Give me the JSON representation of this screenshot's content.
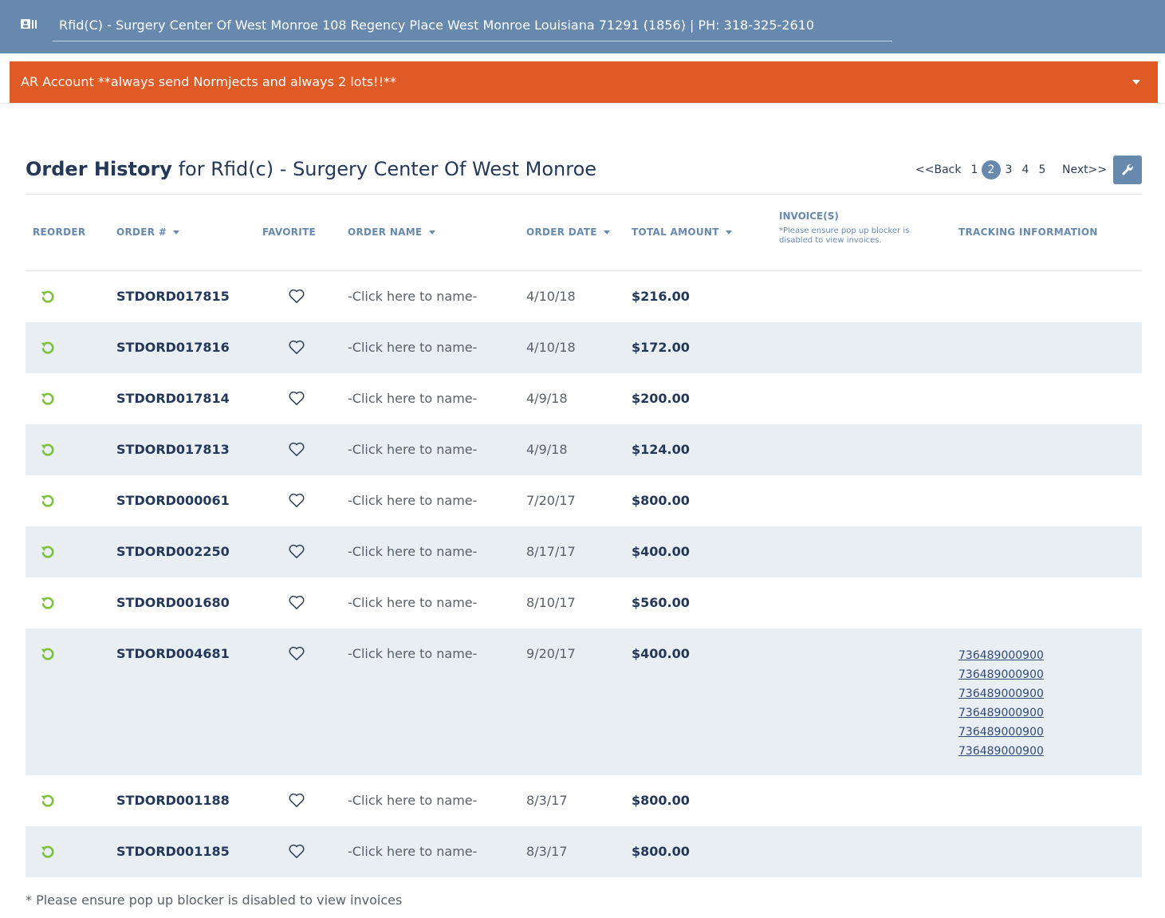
{
  "header": {
    "account_text": "Rfid(C) - Surgery Center Of West Monroe 108 Regency Place West Monroe Louisiana 71291 (1856)  | PH: 318-325-2610",
    "icon": "address-card-icon"
  },
  "alert": {
    "text": "AR Account **always send Normjects and always 2 lots!!**",
    "color": "#e05a26"
  },
  "page": {
    "title_bold": "Order History",
    "title_rest": " for Rfid(c) - Surgery Center Of West Monroe"
  },
  "pagination": {
    "back": "<<Back",
    "pages": [
      "1",
      "2",
      "3",
      "4",
      "5"
    ],
    "current": "2",
    "next": "Next>>",
    "settings_icon": "wrench-icon"
  },
  "table": {
    "columns": {
      "reorder": "REORDER",
      "order_no": "ORDER #",
      "favorite": "FAVORITE",
      "order_name": "ORDER NAME",
      "order_date": "ORDER DATE",
      "total_amount": "TOTAL AMOUNT",
      "invoices": "INVOICE(S)",
      "invoices_note": "*Please ensure pop up blocker is disabled to view invoices.",
      "tracking": "TRACKING INFORMATION"
    },
    "rows": [
      {
        "order_no": "STDORD017815",
        "name": "-Click here to name-",
        "date": "4/10/18",
        "amount": "$216.00",
        "tracking": []
      },
      {
        "order_no": "STDORD017816",
        "name": "-Click here to name-",
        "date": "4/10/18",
        "amount": "$172.00",
        "tracking": []
      },
      {
        "order_no": "STDORD017814",
        "name": "-Click here to name-",
        "date": "4/9/18",
        "amount": "$200.00",
        "tracking": []
      },
      {
        "order_no": "STDORD017813",
        "name": "-Click here to name-",
        "date": "4/9/18",
        "amount": "$124.00",
        "tracking": []
      },
      {
        "order_no": "STDORD000061",
        "name": "-Click here to name-",
        "date": "7/20/17",
        "amount": "$800.00",
        "tracking": []
      },
      {
        "order_no": "STDORD002250",
        "name": "-Click here to name-",
        "date": "8/17/17",
        "amount": "$400.00",
        "tracking": []
      },
      {
        "order_no": "STDORD001680",
        "name": "-Click here to name-",
        "date": "8/10/17",
        "amount": "$560.00",
        "tracking": []
      },
      {
        "order_no": "STDORD004681",
        "name": "-Click here to name-",
        "date": "9/20/17",
        "amount": "$400.00",
        "tracking": [
          "736489000900",
          "736489000900",
          "736489000900",
          "736489000900",
          "736489000900",
          "736489000900"
        ]
      },
      {
        "order_no": "STDORD001188",
        "name": "-Click here to name-",
        "date": "8/3/17",
        "amount": "$800.00",
        "tracking": []
      },
      {
        "order_no": "STDORD001185",
        "name": "-Click here to name-",
        "date": "8/3/17",
        "amount": "$800.00",
        "tracking": []
      }
    ],
    "row_icons": {
      "reorder": "reorder-icon",
      "favorite": "heart-icon"
    },
    "colors": {
      "reorder": "#7cc03e",
      "header": "#6789ae",
      "row_alt": "#e9eef3"
    }
  },
  "footer": {
    "note": "* Please ensure pop up blocker is disabled to view invoices"
  }
}
